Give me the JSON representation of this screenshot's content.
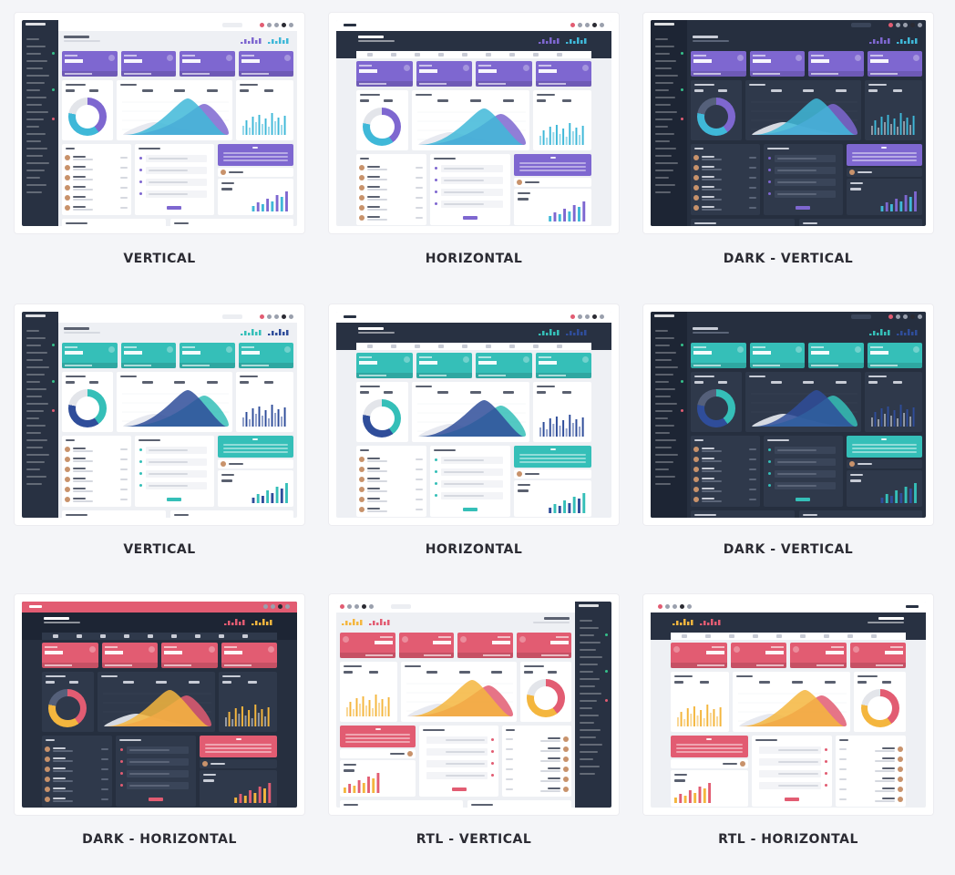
{
  "previews": [
    {
      "caption": "VERTICAL",
      "layout": "vertical",
      "dark": false,
      "rtl": false,
      "accent": "#7e67d0",
      "accent2": "#3fb8d8",
      "nav": "#283142"
    },
    {
      "caption": "HORIZONTAL",
      "layout": "horizontal",
      "dark": false,
      "rtl": false,
      "accent": "#7e67d0",
      "accent2": "#3fb8d8",
      "nav": "#283142"
    },
    {
      "caption": "DARK - VERTICAL",
      "layout": "vertical",
      "dark": true,
      "rtl": false,
      "accent": "#7e67d0",
      "accent2": "#3fb8d8",
      "nav": "#1d2534"
    },
    {
      "caption": "VERTICAL",
      "layout": "vertical",
      "dark": false,
      "rtl": false,
      "accent": "#35bfb8",
      "accent2": "#2f4d9a",
      "nav": "#283142"
    },
    {
      "caption": "HORIZONTAL",
      "layout": "horizontal",
      "dark": false,
      "rtl": false,
      "accent": "#35bfb8",
      "accent2": "#2f4d9a",
      "nav": "#283142"
    },
    {
      "caption": "DARK - VERTICAL",
      "layout": "vertical",
      "dark": true,
      "rtl": false,
      "accent": "#35bfb8",
      "accent2": "#2f4d9a",
      "nav": "#1d2534"
    },
    {
      "caption": "DARK - HORIZONTAL",
      "layout": "horizontal",
      "dark": true,
      "rtl": false,
      "accent": "#e25c72",
      "accent2": "#f4b63e",
      "nav": "#1d2534"
    },
    {
      "caption": "RTL - VERTICAL",
      "layout": "vertical",
      "dark": false,
      "rtl": true,
      "accent": "#e25c72",
      "accent2": "#f4b63e",
      "nav": "#283142"
    },
    {
      "caption": "RTL - HORIZONTAL",
      "layout": "horizontal",
      "dark": false,
      "rtl": true,
      "accent": "#e25c72",
      "accent2": "#f4b63e",
      "nav": "#283142"
    }
  ]
}
